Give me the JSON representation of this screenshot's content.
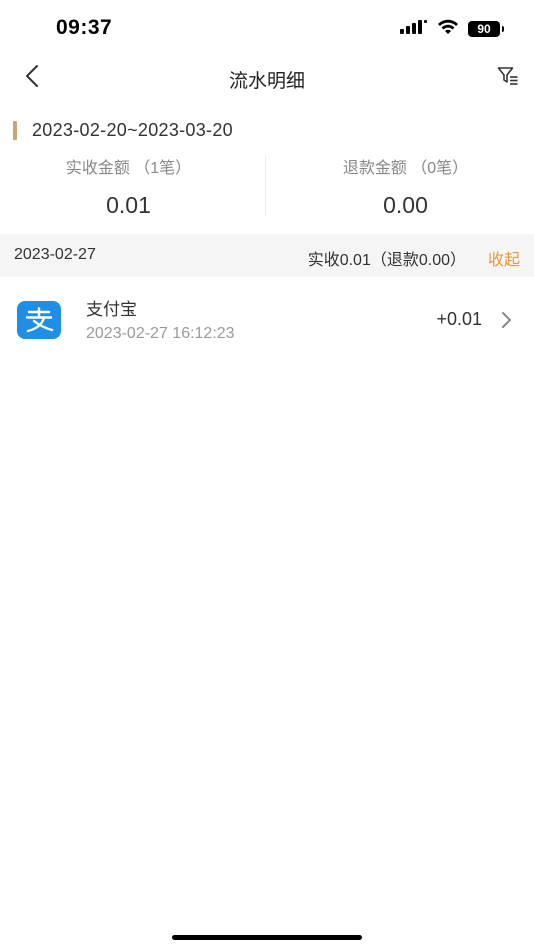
{
  "status_bar": {
    "time": "09:37",
    "battery": "90",
    "icons": [
      "signal-icon",
      "wifi-icon",
      "battery-icon"
    ]
  },
  "nav": {
    "title": "流水明细",
    "icons": [
      "back-chevron-icon",
      "filter-icon"
    ]
  },
  "date_range": "2023-02-20~2023-03-20",
  "summary": {
    "received_label": "实收金额 （1笔）",
    "received_value": "0.01",
    "refund_label": "退款金额 （0笔）",
    "refund_value": "0.00"
  },
  "group": {
    "date": "2023-02-27",
    "summary": "实收0.01（退款0.00）",
    "toggle": "收起"
  },
  "transaction": {
    "icon": "alipay-icon",
    "name": "支付宝",
    "time": "2023-02-27 16:12:23",
    "amount": "+0.01"
  },
  "colors": {
    "accent_bar": "#c7a77a",
    "toggle_orange": "#e89a3c",
    "alipay_blue": "#1f8ee6"
  }
}
